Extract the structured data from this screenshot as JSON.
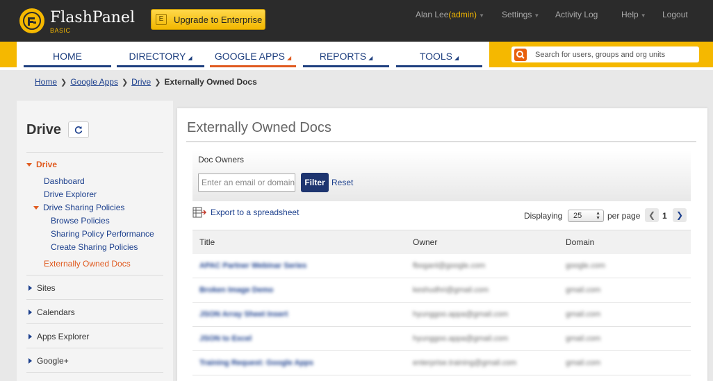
{
  "header": {
    "brand": "FlashPanel",
    "edition": "BASIC",
    "upgrade_badge": "E",
    "upgrade_label": "Upgrade to Enterprise",
    "user_name": "Alan Lee",
    "user_role": "(admin)",
    "settings": "Settings",
    "activity_log": "Activity Log",
    "help": "Help",
    "logout": "Logout"
  },
  "nav": {
    "tabs": [
      {
        "label": "HOME"
      },
      {
        "label": "DIRECTORY"
      },
      {
        "label": "GOOGLE APPS"
      },
      {
        "label": "REPORTS"
      },
      {
        "label": "TOOLS"
      }
    ],
    "search_placeholder": "Search for users, groups and org units"
  },
  "breadcrumb": {
    "items": [
      "Home",
      "Google Apps",
      "Drive"
    ],
    "current": "Externally Owned Docs"
  },
  "sidebar": {
    "title": "Drive",
    "drive_section": "Drive",
    "drive_items": [
      "Dashboard",
      "Drive Explorer"
    ],
    "policies_label": "Drive Sharing Policies",
    "policies_items": [
      "Browse Policies",
      "Sharing Policy Performance",
      "Create Sharing Policies"
    ],
    "active_item": "Externally Owned Docs",
    "sections": [
      "Sites",
      "Calendars",
      "Apps Explorer",
      "Google+"
    ]
  },
  "main": {
    "title": "Externally Owned Docs",
    "filter_label": "Doc Owners",
    "filter_placeholder": "Enter an email or domain",
    "filter_button": "Filter",
    "reset_link": "Reset",
    "export_label": "Export to a spreadsheet",
    "displaying": "Displaying",
    "per_page_value": "25",
    "per_page_label": "per page",
    "current_page": "1"
  },
  "table": {
    "headers": [
      "Title",
      "Owner",
      "Domain"
    ],
    "rows": [
      [
        "APAC Partner Webinar Series",
        "fboganl@google.com",
        "google.com"
      ],
      [
        "Broken Image Demo",
        "keshudhri@gmail.com",
        "gmail.com"
      ],
      [
        "JSON Array Sheet Insert",
        "hyunggoo.appa@gmail.com",
        "gmail.com"
      ],
      [
        "JSON to Excel",
        "hyunggoo.appa@gmail.com",
        "gmail.com"
      ],
      [
        "Training Request: Google Apps",
        "enterprise.training@gmail.com",
        "gmail.com"
      ]
    ]
  },
  "colors": {
    "accent_yellow": "#f5b800",
    "nav_blue": "#1e3f7f",
    "active_orange": "#e05a1f",
    "link_blue": "#1a3e8c"
  }
}
